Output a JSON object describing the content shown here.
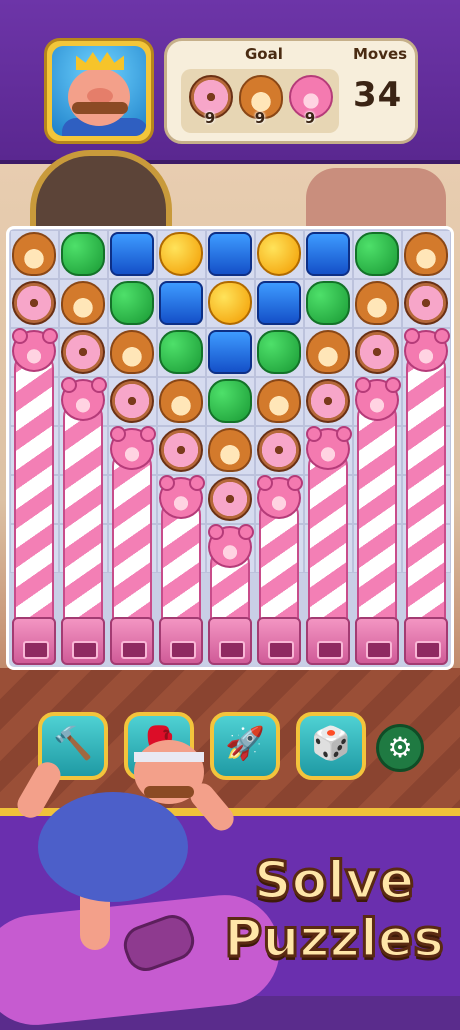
{
  "header": {
    "goal_label": "Goal",
    "moves_label": "Moves",
    "moves_value": "34",
    "goals": [
      {
        "icon": "donut-icon",
        "count": "9"
      },
      {
        "icon": "hamster-icon",
        "count": "9"
      },
      {
        "icon": "pink-bear-icon",
        "count": "9"
      }
    ]
  },
  "boosters": [
    {
      "name": "hammer-booster",
      "icon": "hammer-icon"
    },
    {
      "name": "glove-booster",
      "icon": "boxing-glove-icon"
    },
    {
      "name": "rocket-booster",
      "icon": "rocket-icon"
    },
    {
      "name": "dice-booster",
      "icon": "dice-icon"
    }
  ],
  "settings": {
    "icon": "gear-icon"
  },
  "promo": {
    "line1": "Solve",
    "line2": "Puzzles"
  },
  "board": {
    "columns": 9,
    "tiles": [
      [
        "hamster",
        "clover",
        "jelly",
        "apple",
        "jelly",
        "apple",
        "jelly",
        "clover",
        "hamster"
      ],
      [
        "donut",
        "hamster",
        "clover",
        "jelly",
        "apple",
        "jelly",
        "clover",
        "hamster",
        "donut"
      ],
      [
        "bear-pole",
        "donut",
        "hamster",
        "clover",
        "jelly",
        "clover",
        "hamster",
        "donut",
        "bear-pole"
      ],
      [
        "bear-pole",
        "bear-pole",
        "donut",
        "hamster",
        "clover",
        "hamster",
        "donut",
        "bear-pole",
        "bear-pole"
      ],
      [
        "bear-pole",
        "bear-pole",
        "bear-pole",
        "donut",
        "hamster",
        "donut",
        "bear-pole",
        "bear-pole",
        "bear-pole"
      ],
      [
        "bear-pole",
        "bear-pole",
        "bear-pole",
        "bear-pole",
        "donut",
        "bear-pole",
        "bear-pole",
        "bear-pole",
        "bear-pole"
      ],
      [
        "bear-pole",
        "bear-pole",
        "bear-pole",
        "bear-pole",
        "bear-pole",
        "bear-pole",
        "bear-pole",
        "bear-pole",
        "bear-pole"
      ]
    ]
  }
}
